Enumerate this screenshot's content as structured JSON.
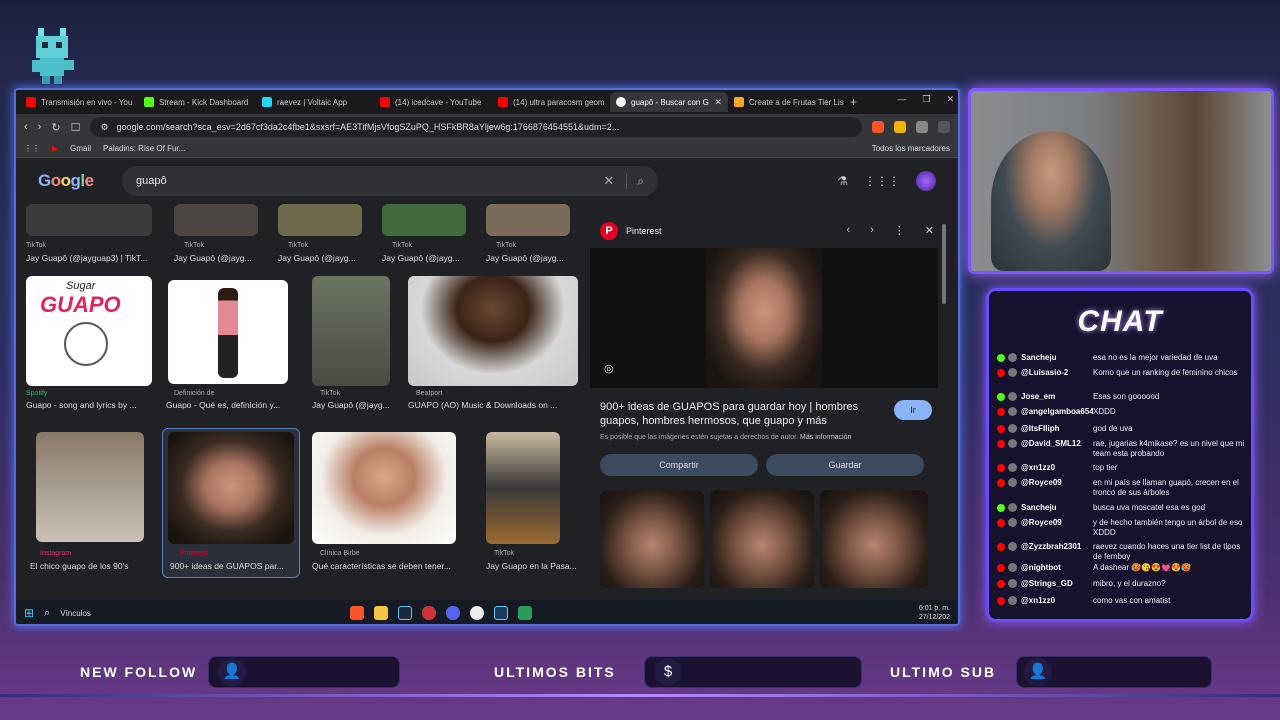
{
  "browser": {
    "tabs": [
      {
        "label": "Transmisión en vivo - You",
        "color": "#ff0000"
      },
      {
        "label": "Stream - Kick Dashboard",
        "color": "#53fc18"
      },
      {
        "label": "raevez | Voltaic App",
        "color": "#24d6ff"
      },
      {
        "label": "(14) icedcave - YouTube",
        "color": "#ff0000"
      },
      {
        "label": "(14) ultra paracosm geom",
        "color": "#ff0000"
      },
      {
        "label": "guapô - Buscar con G",
        "color": "#ffffff",
        "active": true
      },
      {
        "label": "Create a de Frutas Tier Lis",
        "color": "#f5a623"
      }
    ],
    "url": "google.com/search?sca_esv=2d67cf3da2c4fbe1&sxsrf=AE3TifMjsVfogSZuPQ_HSFkBR8aYljew6g:1766876454551&udm=2...",
    "bookmarks": [
      "Gmail",
      "Paladins: Rise Of Fur...",
      "Todos los marcadores"
    ]
  },
  "google": {
    "logo": "Google",
    "query": "guapô"
  },
  "results": [
    {
      "source": "TikTok",
      "title": "Jay Guapô (@jayguap3) | TikT..."
    },
    {
      "source": "TikTok",
      "title": "Jay Guapô (@jayg..."
    },
    {
      "source": "TikTok",
      "title": "Jay Guapô (@jayg..."
    },
    {
      "source": "TikTok",
      "title": "Jay Guapô (@jayg..."
    },
    {
      "source": "TikTok",
      "title": "Jay Guapô (@jayg..."
    },
    {
      "source": "Spotify",
      "title": "Guapo - song and lyrics by ..."
    },
    {
      "source": "Definición de",
      "title": "Guapo - Qué es, definición y..."
    },
    {
      "source": "TikTok",
      "title": "Jay Guapô (@jayg..."
    },
    {
      "source": "Beatport",
      "title": "GUAPO (AO) Music & Downloads on ..."
    },
    {
      "source": "Instagram",
      "title": "El chico guapo de los 90's"
    },
    {
      "source": "Pinterest",
      "title": "900+ ideas de GUAPOS par..."
    },
    {
      "source": "Clínica Birbe",
      "title": "Qué características se deben tener..."
    },
    {
      "source": "TikTok",
      "title": "Jay Guapo en la Pasa..."
    }
  ],
  "spotify_art": {
    "top": "Sugar",
    "main": "GUAPO"
  },
  "panel": {
    "site": "Pinterest",
    "title": "900+ ideas de GUAPOS para guardar hoy | hombres guapos, hombres hermosos, que guapo y más",
    "visit": "Ir",
    "disclaimer": "Es posible que las imágenes estén sujetas a derechos de autor.",
    "more_info": "Más información",
    "share": "Compartir",
    "save": "Guardar"
  },
  "taskbar": {
    "search": "Vínculos",
    "time": "6:01 p. m.",
    "date": "27/12/202"
  },
  "chat": {
    "title": "CHAT",
    "messages": [
      {
        "platform": "kick",
        "user": "Sancheju",
        "text": "esa no es la mejor variedad de uva"
      },
      {
        "platform": "youtube",
        "user": "@Luisasio-2",
        "text": "Komo que un ranking de feminino chicos"
      },
      {
        "platform": "kick",
        "user": "Jose_em",
        "text": "Esas son goooood"
      },
      {
        "platform": "youtube",
        "user": "@angelgamboa6548",
        "text": "XDDD"
      },
      {
        "platform": "youtube",
        "user": "@ItsFIliph",
        "text": "god de uva"
      },
      {
        "platform": "youtube",
        "user": "@David_SML12",
        "text": "rae, jugarias k4mikase? es un nivel que mi team esta probando"
      },
      {
        "platform": "youtube",
        "user": "@xn1zz0",
        "text": "top tier"
      },
      {
        "platform": "youtube",
        "user": "@Royce09",
        "text": "en mi país se llaman guapó, crecen en el tronco de sus árboles"
      },
      {
        "platform": "kick",
        "user": "Sancheju",
        "text": "busca uva moscatel esa es god"
      },
      {
        "platform": "youtube",
        "user": "@Royce09",
        "text": "y de hecho también tengo un árbol de eso XDDD"
      },
      {
        "platform": "youtube",
        "user": "@Zyzzbrah2301",
        "text": "raevez cuando haces una tier list de tipos de femboy"
      },
      {
        "platform": "youtube",
        "user": "@nightbot",
        "text": "A dashear 🥵😘😍💓😍🥵"
      },
      {
        "platform": "youtube",
        "user": "@Strings_GD",
        "text": "mibro, y el durazno?"
      },
      {
        "platform": "youtube",
        "user": "@xn1zz0",
        "text": "como vas con amatist"
      }
    ]
  },
  "bottom": {
    "new_follow": "NEW FOLLOW",
    "ultimos_bits": "ULTIMOS BITS",
    "ultimo_sub": "ULTIMO SUB"
  },
  "colors": {
    "accent": "#6a4cff",
    "kick": "#53fc18",
    "youtube": "#ff0000"
  }
}
